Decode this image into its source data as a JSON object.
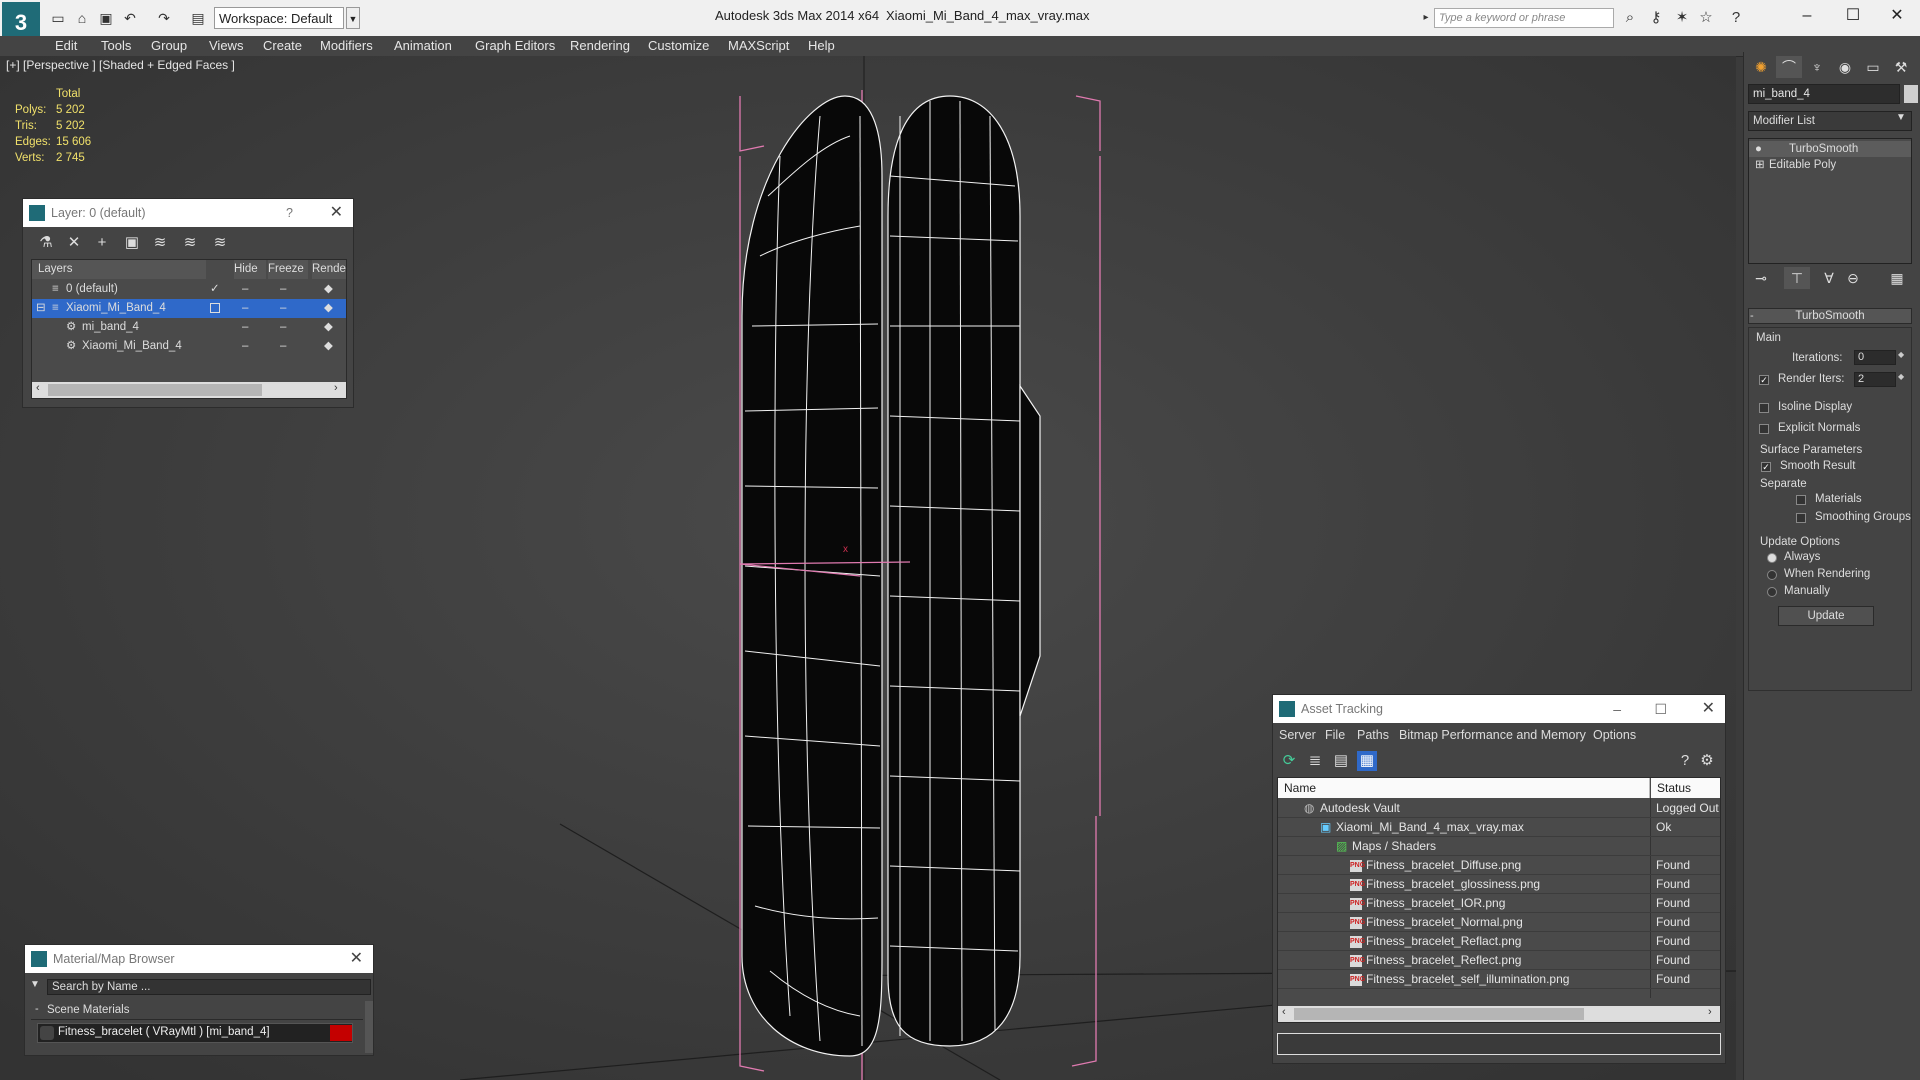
{
  "titlebar": {
    "workspace": "Workspace: Default",
    "app_title": "Autodesk 3ds Max  2014 x64",
    "file_title": "Xiaomi_Mi_Band_4_max_vray.max",
    "search_placeholder": "Type a keyword or phrase"
  },
  "menu": [
    "Edit",
    "Tools",
    "Group",
    "Views",
    "Create",
    "Modifiers",
    "Animation",
    "Graph Editors",
    "Rendering",
    "Customize",
    "MAXScript",
    "Help"
  ],
  "viewport": {
    "label": "[+] [Perspective ] [Shaded + Edged Faces ]",
    "stats_header": "Total",
    "stats": [
      {
        "label": "Polys:",
        "value": "5 202"
      },
      {
        "label": "Tris:",
        "value": "5 202"
      },
      {
        "label": "Edges:",
        "value": "15 606"
      },
      {
        "label": "Verts:",
        "value": "2 745"
      }
    ]
  },
  "layer_panel": {
    "title": "Layer: 0 (default)",
    "help": "?",
    "columns": [
      "Layers",
      "Hide",
      "Freeze",
      "Render"
    ],
    "rows": [
      {
        "name": "0 (default)",
        "check": "✓"
      },
      {
        "name": "Xiaomi_Mi_Band_4"
      },
      {
        "name": "mi_band_4"
      },
      {
        "name": "Xiaomi_Mi_Band_4"
      }
    ]
  },
  "command_panel": {
    "object_name": "mi_band_4",
    "modifier_list": "Modifier List",
    "stack": [
      "TurboSmooth",
      "Editable Poly"
    ],
    "turbosmooth": {
      "header": "TurboSmooth",
      "main": "Main",
      "iterations_label": "Iterations:",
      "iterations": "0",
      "render_iters_label": "Render Iters:",
      "render_iters": "2",
      "isoline": "Isoline Display",
      "explicit_normals": "Explicit Normals",
      "surface_params": "Surface Parameters",
      "smooth_result": "Smooth Result",
      "separate": "Separate",
      "materials": "Materials",
      "smoothing_groups": "Smoothing Groups",
      "update_options": "Update Options",
      "always": "Always",
      "when_rendering": "When Rendering",
      "manually": "Manually",
      "update_button": "Update"
    }
  },
  "material_browser": {
    "title": "Material/Map Browser",
    "search_placeholder": "Search by Name ...",
    "section": "Scene Materials",
    "item": "Fitness_bracelet  ( VRayMtl )  [mi_band_4]"
  },
  "asset_tracking": {
    "title": "Asset Tracking",
    "menu": [
      "Server",
      "File",
      "Paths",
      "Bitmap Performance and Memory",
      "Options"
    ],
    "col_name": "Name",
    "col_status": "Status",
    "rows": [
      {
        "name": "Autodesk Vault",
        "status": "Logged Out",
        "indent": 0
      },
      {
        "name": "Xiaomi_Mi_Band_4_max_vray.max",
        "status": "Ok",
        "indent": 1
      },
      {
        "name": "Maps / Shaders",
        "status": "",
        "indent": 2
      },
      {
        "name": "Fitness_bracelet_Diffuse.png",
        "status": "Found",
        "indent": 3
      },
      {
        "name": "Fitness_bracelet_glossiness.png",
        "status": "Found",
        "indent": 3
      },
      {
        "name": "Fitness_bracelet_IOR.png",
        "status": "Found",
        "indent": 3
      },
      {
        "name": "Fitness_bracelet_Normal.png",
        "status": "Found",
        "indent": 3
      },
      {
        "name": "Fitness_bracelet_Reflact.png",
        "status": "Found",
        "indent": 3
      },
      {
        "name": "Fitness_bracelet_Reflect.png",
        "status": "Found",
        "indent": 3
      },
      {
        "name": "Fitness_bracelet_self_illumination.png",
        "status": "Found",
        "indent": 3
      }
    ]
  }
}
